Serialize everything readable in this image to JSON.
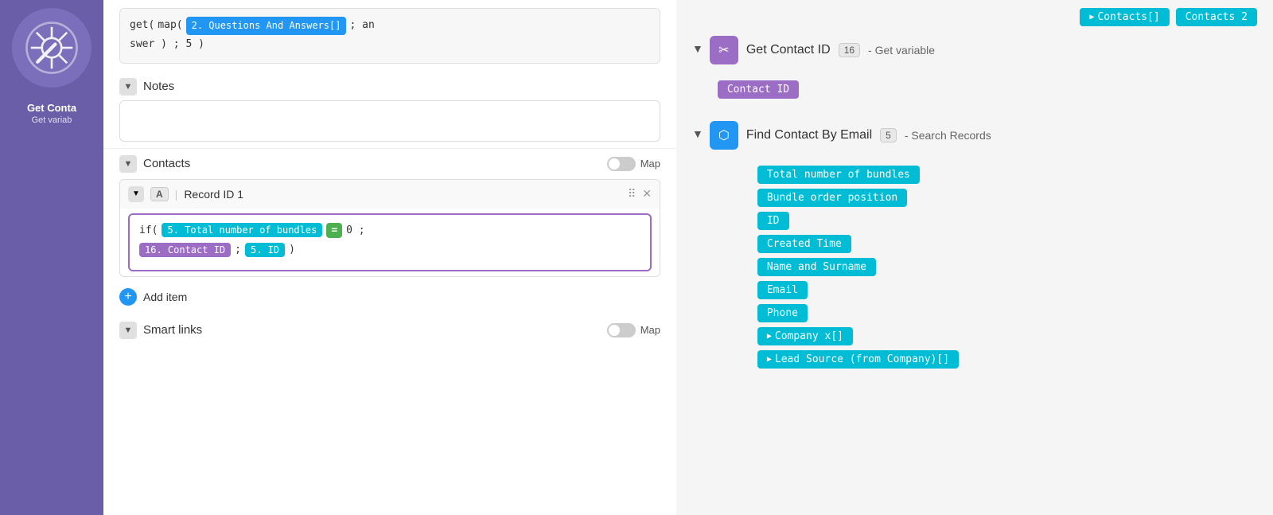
{
  "sidebar": {
    "label": "Get Conta",
    "sublabel": "Get variab"
  },
  "leftPanel": {
    "codeBlock": {
      "line1": [
        "get(",
        "map(",
        "2. Questions And Answers[]",
        "; an"
      ],
      "line2": [
        "swer",
        ")",
        ";",
        "5",
        ")"
      ]
    },
    "notes": {
      "title": "Notes",
      "placeholder": ""
    },
    "contacts": {
      "title": "Contacts",
      "mapLabel": "Map",
      "record": {
        "typeBadge": "A",
        "name": "Record ID 1",
        "formula": {
          "line1_if": "if(",
          "line1_tag": "5. Total number of bundles",
          "line1_eq": "=",
          "line1_val": "0",
          "line1_semi": ";",
          "line2_tag1": "16. Contact ID",
          "line2_semi": ";",
          "line2_tag2": "5. ID",
          "line2_close": ")"
        }
      },
      "addItem": "Add item"
    },
    "smartLinks": {
      "title": "Smart links",
      "mapLabel": "Map"
    }
  },
  "rightPanel": {
    "topTags": [
      "Contacts[]",
      "Contacts 2"
    ],
    "getContact": {
      "title": "Get Contact ID",
      "badge": "16",
      "subtitle": "- Get variable",
      "contactIdTag": "Contact ID"
    },
    "findContact": {
      "title": "Find Contact By Email",
      "badge": "5",
      "subtitle": "- Search Records",
      "tags": [
        "Total number of bundles",
        "Bundle order position",
        "ID",
        "Created Time",
        "Name and Surname",
        "Email",
        "Phone",
        "Company x[]",
        "Lead Source (from Company)[]"
      ]
    }
  }
}
